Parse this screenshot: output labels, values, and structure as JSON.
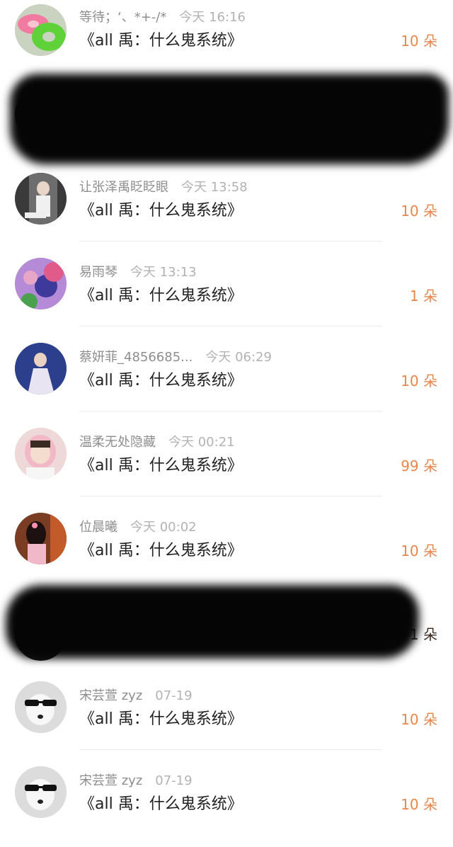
{
  "gift_list": {
    "rows": [
      {
        "user": "等待；‘、*+-/*",
        "time": "今天 16:16",
        "title": "《all 禹：什么鬼系统》",
        "count": "10 朵"
      },
      {
        "user": "",
        "time": "",
        "title": "",
        "count": ""
      },
      {
        "user": "让张泽禹眨眨眼",
        "time": "今天 13:58",
        "title": "《all 禹：什么鬼系统》",
        "count": "10 朵"
      },
      {
        "user": "易雨琴",
        "time": "今天 13:13",
        "title": "《all 禹：什么鬼系统》",
        "count": "1 朵"
      },
      {
        "user": "蔡妍菲_4856685...",
        "time": "今天 06:29",
        "title": "《all 禹：什么鬼系统》",
        "count": "10 朵"
      },
      {
        "user": "温柔无处隐藏",
        "time": "今天 00:21",
        "title": "《all 禹：什么鬼系统》",
        "count": "99 朵"
      },
      {
        "user": "位晨曦",
        "time": "今天 00:02",
        "title": "《all 禹：什么鬼系统》",
        "count": "10 朵"
      },
      {
        "user": "",
        "time": "",
        "title": "",
        "count": "1 朵"
      },
      {
        "user": "宋芸萱 zyz",
        "time": "07-19",
        "title": "《all 禹：什么鬼系统》",
        "count": "10 朵"
      },
      {
        "user": "宋芸萱 zyz",
        "time": "07-19",
        "title": "《all 禹：什么鬼系统》",
        "count": "10 朵"
      }
    ]
  },
  "colors": {
    "count": "#e8874a",
    "meta": "#8e8e8e",
    "title": "#222222",
    "redaction": "#050505"
  }
}
